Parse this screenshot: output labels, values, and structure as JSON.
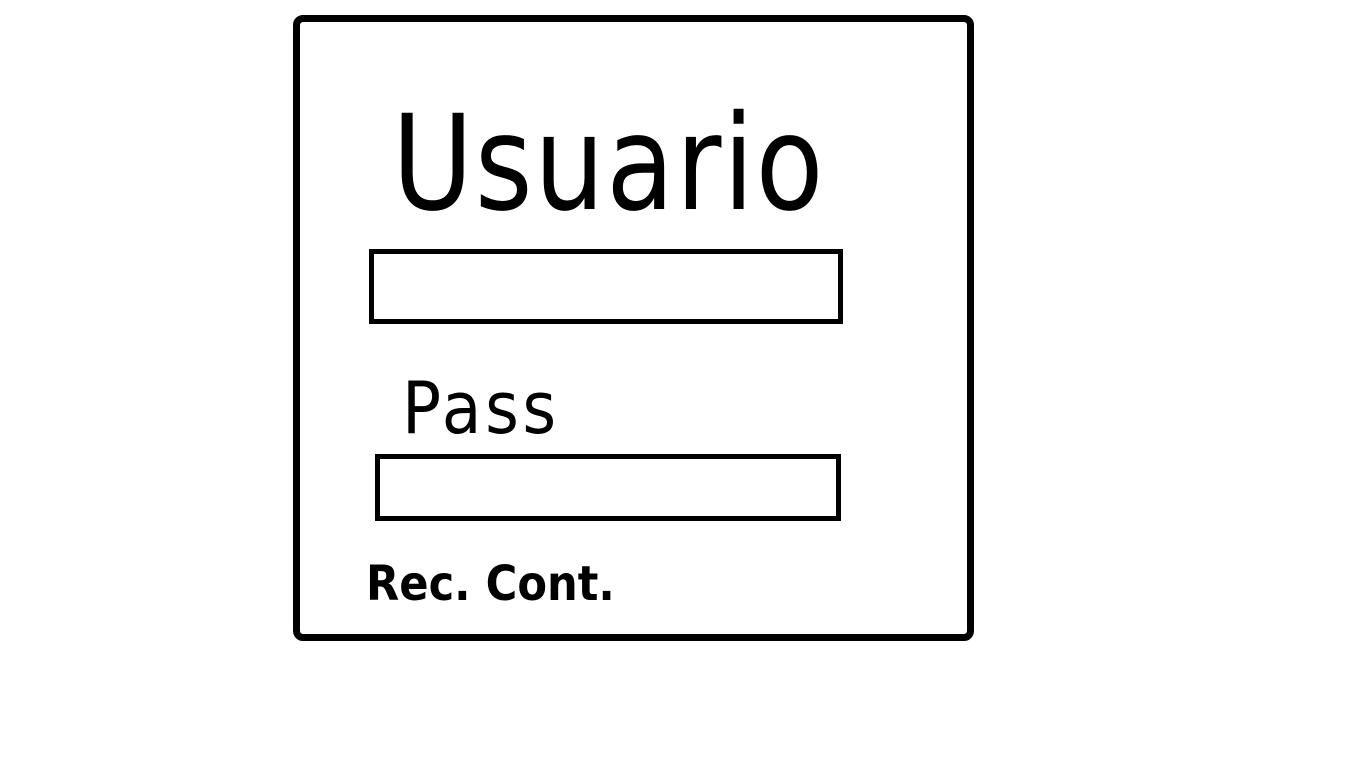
{
  "login": {
    "username_label": "Usuario",
    "username_value": "",
    "password_label": "Pass",
    "password_value": "",
    "recover_link": "Rec. Cont."
  }
}
